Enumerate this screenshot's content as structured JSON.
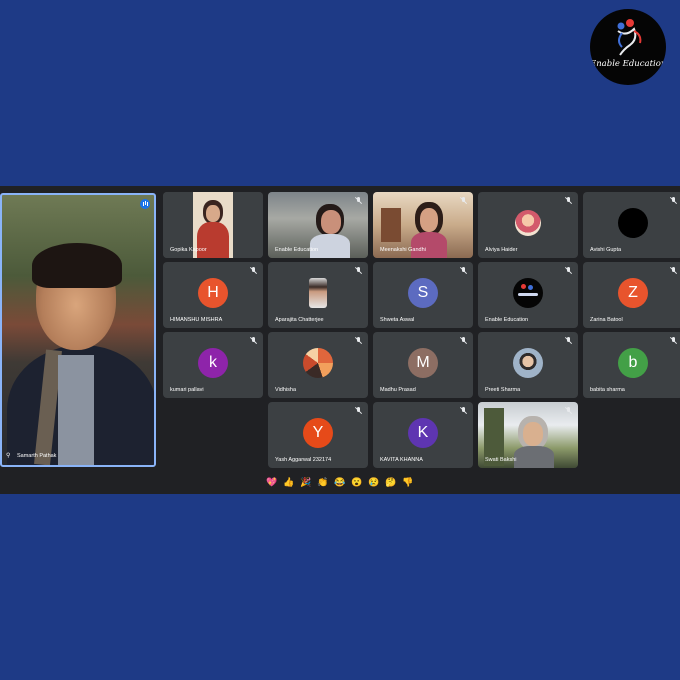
{
  "logo": {
    "text": "Enable Education"
  },
  "speaker": {
    "name": "Samarth Pathak"
  },
  "participants": [
    {
      "name": "Gopika Kapoor",
      "type": "video"
    },
    {
      "name": "Enable Education",
      "type": "video"
    },
    {
      "name": "Meenakshi Gandhi",
      "type": "video"
    },
    {
      "name": "Alviya Haider",
      "type": "image"
    },
    {
      "name": "Avishi Gupta",
      "type": "image"
    },
    {
      "name": "HIMANSHU MISHRA",
      "type": "letter",
      "letter": "H",
      "color": "#e8542d"
    },
    {
      "name": "Aparajita Chatterjee",
      "type": "portrait"
    },
    {
      "name": "Shweta Aswal",
      "type": "letter",
      "letter": "S",
      "color": "#5c6bc0"
    },
    {
      "name": "Enable Education",
      "type": "image"
    },
    {
      "name": "Zarina Batool",
      "type": "letter",
      "letter": "Z",
      "color": "#e8542d"
    },
    {
      "name": "kumari pallavi",
      "type": "letter",
      "letter": "k",
      "color": "#8e24aa"
    },
    {
      "name": "Vidhisha",
      "type": "image"
    },
    {
      "name": "Madhu Prasad",
      "type": "letter",
      "letter": "M",
      "color": "#8d6e63"
    },
    {
      "name": "Preeti Sharma",
      "type": "image"
    },
    {
      "name": "babita sharma",
      "type": "letter",
      "letter": "b",
      "color": "#43a047"
    },
    {
      "name": "Yash Aggarwal 232174",
      "type": "letter",
      "letter": "Y",
      "color": "#e64a19"
    },
    {
      "name": "KAVITA KHANNA",
      "type": "letter",
      "letter": "K",
      "color": "#5e35b1"
    },
    {
      "name": "Swati Bakshi",
      "type": "video"
    }
  ],
  "reactions": [
    "💖",
    "👍",
    "🎉",
    "👏",
    "😂",
    "😮",
    "😢",
    "🤔",
    "👎"
  ]
}
